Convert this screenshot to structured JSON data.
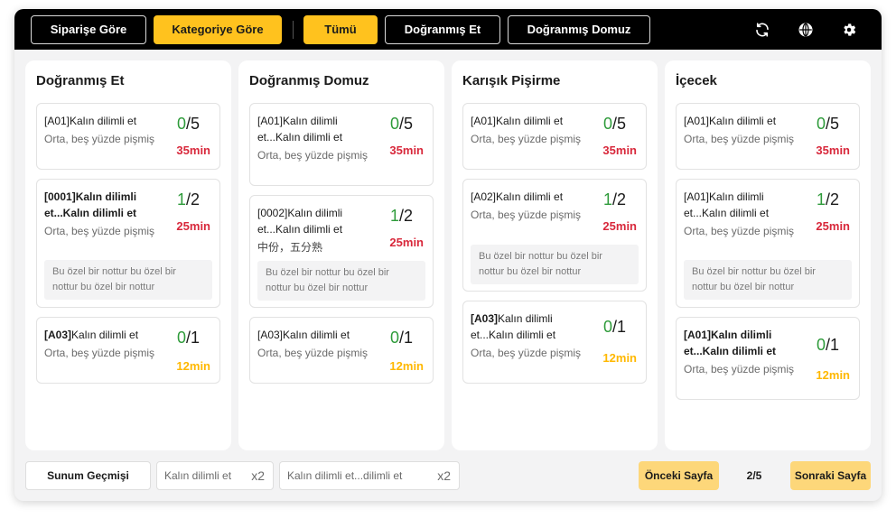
{
  "topbar": {
    "view_modes": [
      "Siparişe Göre",
      "Kategoriye Göre"
    ],
    "categories": [
      "Tümü",
      "Doğranmış Et",
      "Doğranmış Domuz"
    ],
    "icons": [
      "refresh-icon",
      "globe-icon",
      "gear-icon"
    ]
  },
  "columns": [
    {
      "title": "Doğranmış Et",
      "cards": [
        {
          "code": "[A01]",
          "name": "Kalın dilimli et",
          "modifier": "Orta, beş yüzde pişmiş",
          "done": "0",
          "total": "/5",
          "time": "35min",
          "note": ""
        },
        {
          "code": "[0001]",
          "name": "Kalın dilimli et...Kalın dilimli et",
          "modifier": "Orta, beş yüzde pişmiş",
          "done": "1",
          "total": "/2",
          "time": "25min",
          "note": "Bu özel bir nottur bu özel bir nottur bu özel bir nottur"
        },
        {
          "code": "[A03]",
          "name": "Kalın dilimli et",
          "modifier": "Orta, beş yüzde pişmiş",
          "done": "0",
          "total": "/1",
          "time": "12min",
          "note": ""
        }
      ]
    },
    {
      "title": "Doğranmış Domuz",
      "cards": [
        {
          "code": "[A01]",
          "name": "Kalın dilimli et...Kalın dilimli et",
          "modifier": "Orta, beş yüzde pişmiş",
          "done": "0",
          "total": "/5",
          "time": "35min",
          "note": ""
        },
        {
          "code": "[0002]",
          "name": "Kalın dilimli et...Kalın dilimli et",
          "modifier": "中份，五分熟",
          "done": "1",
          "total": "/2",
          "time": "25min",
          "note": "Bu özel bir nottur bu özel bir nottur bu özel bir nottur"
        },
        {
          "code": "[A03]",
          "name": "Kalın dilimli et",
          "modifier": "Orta, beş yüzde pişmiş",
          "done": "0",
          "total": "/1",
          "time": "12min",
          "note": ""
        }
      ]
    },
    {
      "title": "Karışık Pişirme",
      "cards": [
        {
          "code": "[A01]",
          "name": "Kalın dilimli et",
          "modifier": "Orta, beş yüzde pişmiş",
          "done": "0",
          "total": "/5",
          "time": "35min",
          "note": ""
        },
        {
          "code": "[A02]",
          "name": "Kalın dilimli et",
          "modifier": "Orta, beş yüzde pişmiş",
          "done": "1",
          "total": "/2",
          "time": "25min",
          "note": "Bu özel bir nottur bu özel bir nottur bu özel bir nottur"
        },
        {
          "code": "[A03]",
          "name": "Kalın dilimli et...Kalın dilimli et",
          "modifier": "Orta, beş yüzde pişmiş",
          "done": "0",
          "total": "/1",
          "time": "12min",
          "note": ""
        }
      ]
    },
    {
      "title": "İçecek",
      "cards": [
        {
          "code": "[A01]",
          "name": "Kalın dilimli et",
          "modifier": "Orta, beş yüzde pişmiş",
          "done": "0",
          "total": "/5",
          "time": "35min",
          "note": ""
        },
        {
          "code": "[A01]",
          "name": "Kalın dilimli et...Kalın dilimli et",
          "modifier": "Orta, beş yüzde pişmiş",
          "done": "1",
          "total": "/2",
          "time": "25min",
          "note": "Bu özel bir nottur bu özel bir nottur bu özel bir nottur"
        },
        {
          "code": "[A01]",
          "name": "Kalın dilimli et...Kalın dilimli et",
          "modifier": "Orta, beş yüzde pişmiş",
          "done": "0",
          "total": "/1",
          "time": "12min",
          "note": ""
        }
      ]
    }
  ],
  "bottombar": {
    "history_label": "Sunum Geçmişi",
    "served": [
      {
        "name": "Kalın dilimli et",
        "qty": "x2"
      },
      {
        "name": "Kalın dilimli et...dilimli et",
        "qty": "x2"
      }
    ],
    "prev_label": "Önceki Sayfa",
    "page_info": "2/5",
    "next_label": "Sonraki Sayfa"
  },
  "colors": {
    "accent": "#ffc21e",
    "done_count": "#2e9b3a",
    "urgent_time": "#d8283b",
    "normal_time": "#ffb800",
    "pager_button": "#fdd77a"
  }
}
